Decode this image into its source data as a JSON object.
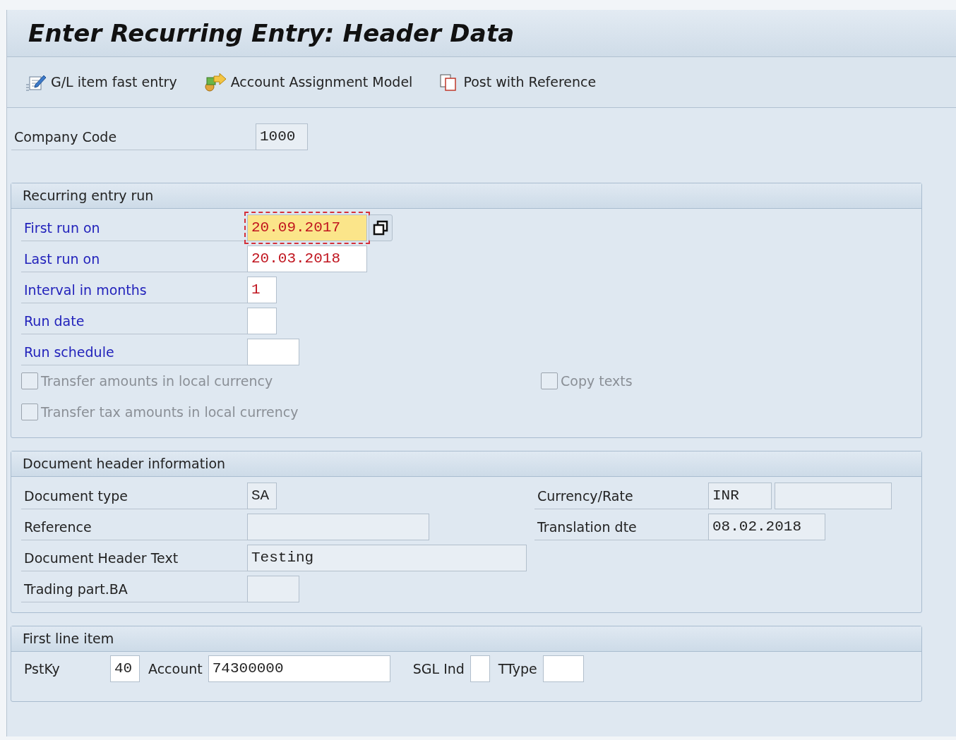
{
  "title": "Enter Recurring Entry: Header Data",
  "toolbar": [
    {
      "label": "G/L item fast entry",
      "kind": "fast-entry"
    },
    {
      "label": "Account Assignment Model",
      "kind": "model"
    },
    {
      "label": "Post with Reference",
      "kind": "reference"
    }
  ],
  "company_code": {
    "label": "Company Code",
    "value": "1000",
    "editable": false
  },
  "recurring_run": {
    "title": "Recurring entry run",
    "fields": [
      {
        "label": "First run on",
        "value": "20.09.2017",
        "required": true,
        "focused": true,
        "editable": true
      },
      {
        "label": "Last run on",
        "value": "20.03.2018",
        "required": true,
        "focused": false,
        "editable": true
      },
      {
        "label": "Interval in months",
        "value": "1",
        "required": true,
        "focused": false,
        "editable": true
      },
      {
        "label": "Run date",
        "required": true,
        "focused": false,
        "editable": true
      },
      {
        "label": "Run schedule",
        "required": true,
        "focused": false,
        "editable": true
      }
    ],
    "checkboxes": [
      {
        "label": "Transfer amounts in local currency",
        "checked": false,
        "disabled": true
      },
      {
        "label": "Copy texts",
        "checked": false,
        "disabled": true
      },
      {
        "label": "Transfer tax amounts in local currency",
        "checked": false,
        "disabled": true
      }
    ]
  },
  "document_header": {
    "title": "Document header information",
    "left": [
      {
        "label": "Document type",
        "value": "SA",
        "kind": "single",
        "editable": false
      },
      {
        "label": "Reference",
        "kind": "single",
        "editable": false
      },
      {
        "label": "Document Header Text",
        "value": "Testing",
        "kind": "single",
        "editable": false
      },
      {
        "label": "Trading part.BA",
        "kind": "single",
        "editable": false
      }
    ],
    "right": [
      {
        "label": "Currency/Rate",
        "value": "INR",
        "kind": "pair",
        "editable": false
      },
      {
        "label": "Translation dte",
        "value": "08.02.2018",
        "kind": "single",
        "editable": false
      }
    ]
  },
  "first_line_item": {
    "title": "First line item",
    "fields": [
      {
        "label": "PstKy",
        "value": "40"
      },
      {
        "label": "Account",
        "value": "74300000"
      },
      {
        "label": "SGL Ind"
      },
      {
        "label": "TType"
      }
    ]
  }
}
